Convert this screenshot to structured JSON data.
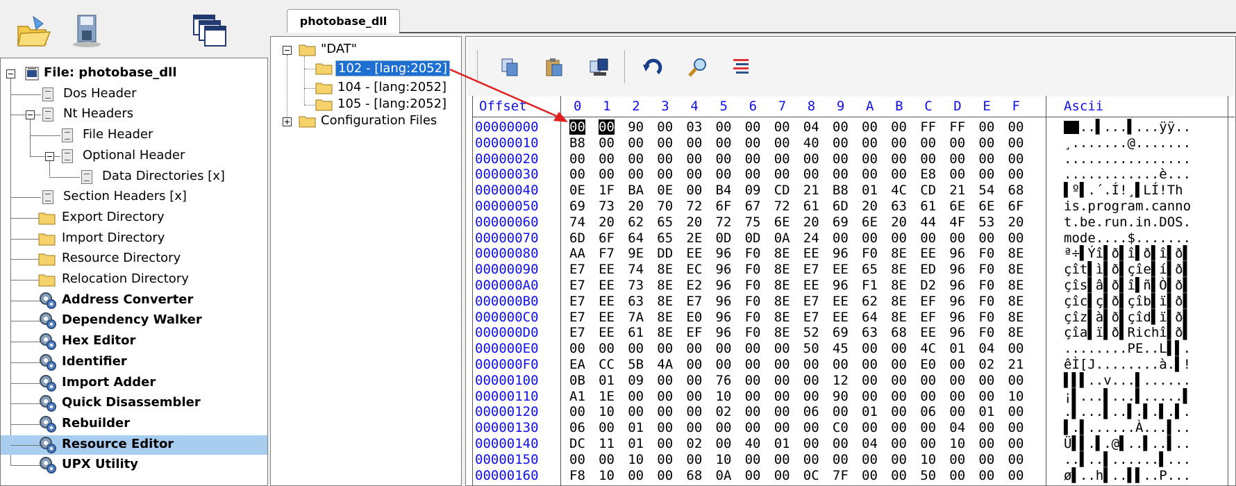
{
  "tab": {
    "label": "photobase_dll"
  },
  "tree": {
    "items": [
      {
        "label": "File: photobase_dll",
        "bold": true
      },
      {
        "label": "Dos Header"
      },
      {
        "label": "Nt Headers"
      },
      {
        "label": "File Header"
      },
      {
        "label": "Optional Header"
      },
      {
        "label": "Data Directories [x]"
      },
      {
        "label": "Section Headers [x]"
      },
      {
        "label": "Export Directory"
      },
      {
        "label": "Import Directory"
      },
      {
        "label": "Resource Directory"
      },
      {
        "label": "Relocation Directory"
      },
      {
        "label": "Address Converter",
        "bold": true
      },
      {
        "label": "Dependency Walker",
        "bold": true
      },
      {
        "label": "Hex Editor",
        "bold": true
      },
      {
        "label": "Identifier",
        "bold": true
      },
      {
        "label": "Import Adder",
        "bold": true
      },
      {
        "label": "Quick Disassembler",
        "bold": true
      },
      {
        "label": "Rebuilder",
        "bold": true
      },
      {
        "label": "Resource Editor",
        "bold": true,
        "selected": true
      },
      {
        "label": "UPX Utility",
        "bold": true
      }
    ]
  },
  "resources": {
    "root": "\"DAT\"",
    "children": [
      "102 - [lang:2052]",
      "104 - [lang:2052]",
      "105 - [lang:2052]"
    ],
    "other": "Configuration Files"
  },
  "hex": {
    "offset_header": "Offset",
    "ascii_header": "Ascii",
    "columns": [
      "0",
      "1",
      "2",
      "3",
      "4",
      "5",
      "6",
      "7",
      "8",
      "9",
      "A",
      "B",
      "C",
      "D",
      "E",
      "F"
    ],
    "rows": [
      {
        "offset": "00000000",
        "bytes": "00 00 90 00 03 00 00 00 04 00 00 00 FF FF 00 00",
        "ascii": "  ..▌...▌...ÿÿ.."
      },
      {
        "offset": "00000010",
        "bytes": "B8 00 00 00 00 00 00 00 40 00 00 00 00 00 00 00",
        "ascii": "¸.......@......."
      },
      {
        "offset": "00000020",
        "bytes": "00 00 00 00 00 00 00 00 00 00 00 00 00 00 00 00",
        "ascii": "................"
      },
      {
        "offset": "00000030",
        "bytes": "00 00 00 00 00 00 00 00 00 00 00 00 E8 00 00 00",
        "ascii": "............è..."
      },
      {
        "offset": "00000040",
        "bytes": "0E 1F BA 0E 00 B4 09 CD 21 B8 01 4C CD 21 54 68",
        "ascii": "▌º▌.´.Í!¸▌LÍ!Th"
      },
      {
        "offset": "00000050",
        "bytes": "69 73 20 70 72 6F 67 72 61 6D 20 63 61 6E 6E 6F",
        "ascii": "is.program.canno"
      },
      {
        "offset": "00000060",
        "bytes": "74 20 62 65 20 72 75 6E 20 69 6E 20 44 4F 53 20",
        "ascii": "t.be.run.in.DOS."
      },
      {
        "offset": "00000070",
        "bytes": "6D 6F 64 65 2E 0D 0D 0A 24 00 00 00 00 00 00 00",
        "ascii": "mode....$......."
      },
      {
        "offset": "00000080",
        "bytes": "AA F7 9E DD EE 96 F0 8E EE 96 F0 8E EE 96 F0 8E",
        "ascii": "ª÷▌Ýî▌ð▌î▌ð▌î▌ð▌"
      },
      {
        "offset": "00000090",
        "bytes": "E7 EE 74 8E EC 96 F0 8E E7 EE 65 8E ED 96 F0 8E",
        "ascii": "çît▌ì▌ð▌çîe▌í▌ð▌"
      },
      {
        "offset": "000000A0",
        "bytes": "E7 EE 73 8E E2 96 F0 8E EE 96 F1 8E D2 96 F0 8E",
        "ascii": "çîs▌â▌ð▌î▌ñ▌Ò▌ð▌"
      },
      {
        "offset": "000000B0",
        "bytes": "E7 EE 63 8E E7 96 F0 8E E7 EE 62 8E EF 96 F0 8E",
        "ascii": "çîc▌ç▌ð▌çîb▌ï▌ð▌"
      },
      {
        "offset": "000000C0",
        "bytes": "E7 EE 7A 8E E0 96 F0 8E E7 EE 64 8E EF 96 F0 8E",
        "ascii": "çîz▌à▌ð▌çîd▌ï▌ð▌"
      },
      {
        "offset": "000000D0",
        "bytes": "E7 EE 61 8E EF 96 F0 8E 52 69 63 68 EE 96 F0 8E",
        "ascii": "çîa▌ï▌ð▌Richî▌ð▌"
      },
      {
        "offset": "000000E0",
        "bytes": "00 00 00 00 00 00 00 00 50 45 00 00 4C 01 04 00",
        "ascii": "........PE..L▌▌."
      },
      {
        "offset": "000000F0",
        "bytes": "EA CC 5B 4A 00 00 00 00 00 00 00 00 E0 00 02 21",
        "ascii": "êÌ[J........à.▌!"
      },
      {
        "offset": "00000100",
        "bytes": "0B 01 09 00 00 76 00 00 00 12 00 00 00 00 00 00",
        "ascii": "▌▌▌..v...▌......"
      },
      {
        "offset": "00000110",
        "bytes": "A1 1E 00 00 00 10 00 00 00 90 00 00 00 00 00 10",
        "ascii": "¡▌...▌...▌.....▌"
      },
      {
        "offset": "00000120",
        "bytes": "00 10 00 00 00 02 00 00 06 00 01 00 06 00 01 00",
        "ascii": ".▌...▌..▌.▌.▌.▌."
      },
      {
        "offset": "00000130",
        "bytes": "06 00 01 00 00 00 00 00 00 C0 00 00 00 04 00 00",
        "ascii": "▌.▌......À...▌.."
      },
      {
        "offset": "00000140",
        "bytes": "DC 11 01 00 02 00 40 01 00 00 04 00 00 10 00 00",
        "ascii": "Ü▌▌.▌.@▌..▌..▌.."
      },
      {
        "offset": "00000150",
        "bytes": "00 00 10 00 00 10 00 00 00 00 00 00 10 00 00 00",
        "ascii": "..▌..▌......▌..."
      },
      {
        "offset": "00000160",
        "bytes": "F8 10 00 00 68 0A 00 00 0C 7F 00 00 50 00 00 00",
        "ascii": "ø▌..h▌..▌▌..P..."
      }
    ]
  },
  "colors": {
    "selection": "#1e6fd2",
    "hex_blue": "#1010ee",
    "annotation": "#e02020"
  }
}
